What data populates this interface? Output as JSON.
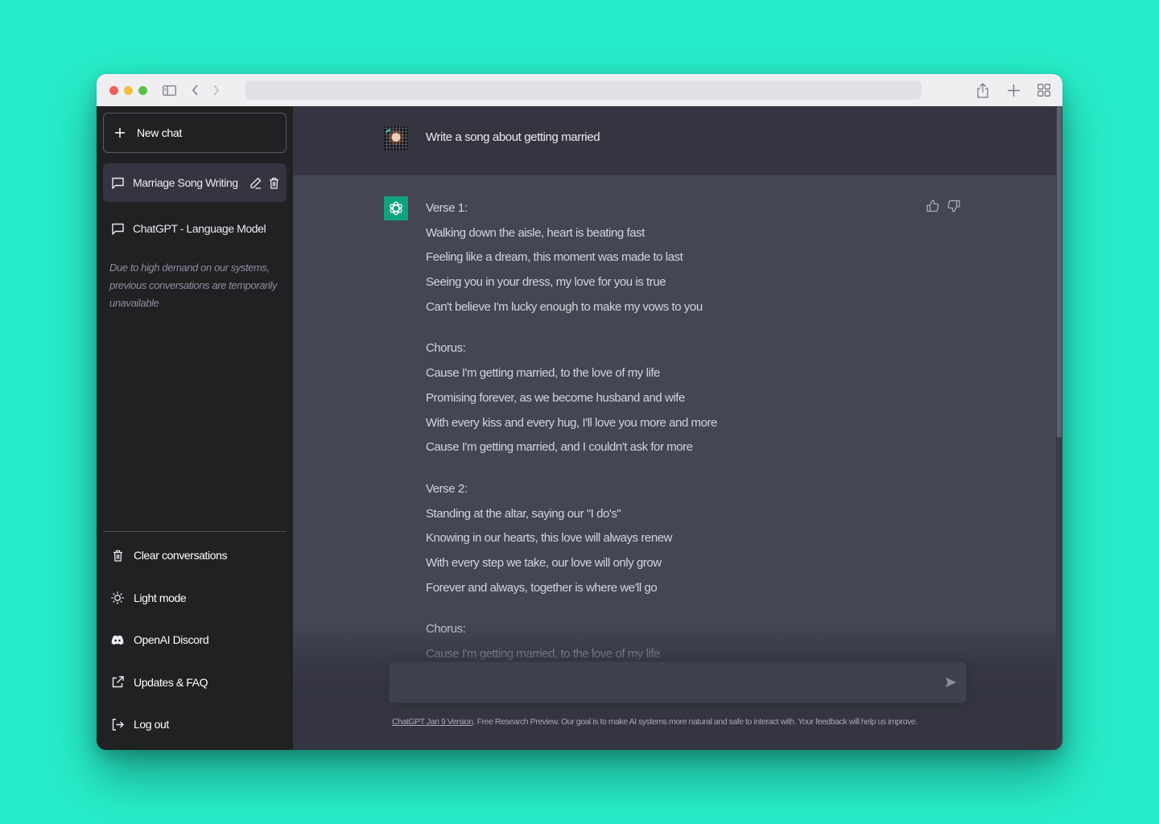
{
  "browser": {
    "url": "",
    "icons": [
      "sidebar-toggle-icon",
      "back-icon",
      "forward-icon",
      "share-icon",
      "new-tab-icon",
      "tab-overview-icon"
    ]
  },
  "sidebar": {
    "new_chat_label": "New chat",
    "conversations": [
      {
        "title": "Marriage Song Writing",
        "active": true
      },
      {
        "title": "ChatGPT - Language Model",
        "active": false
      }
    ],
    "notice": "Due to high demand on our systems, previous conversations are temporarily unavailable",
    "menu": [
      {
        "label": "Clear conversations",
        "icon": "trash-icon"
      },
      {
        "label": "Light mode",
        "icon": "sun-icon"
      },
      {
        "label": "OpenAI Discord",
        "icon": "discord-icon"
      },
      {
        "label": "Updates & FAQ",
        "icon": "external-link-icon"
      },
      {
        "label": "Log out",
        "icon": "logout-icon"
      }
    ]
  },
  "chat": {
    "user_message": "Write a song about getting married",
    "assistant_message": {
      "stanzas": [
        {
          "lines": [
            "Verse 1:",
            "Walking down the aisle, heart is beating fast",
            "Feeling like a dream, this moment was made to last",
            "Seeing you in your dress, my love for you is true",
            "Can't believe I'm lucky enough to make my vows to you"
          ]
        },
        {
          "lines": [
            "Chorus:",
            "Cause I'm getting married, to the love of my life",
            "Promising forever, as we become husband and wife",
            "With every kiss and every hug, I'll love you more and more",
            "Cause I'm getting married, and I couldn't ask for more"
          ]
        },
        {
          "lines": [
            "Verse 2:",
            "Standing at the altar, saying our \"I do's\"",
            "Knowing in our hearts, this love will always renew",
            "With every step we take, our love will only grow",
            "Forever and always, together is where we'll go"
          ]
        },
        {
          "lines": [
            "Chorus:",
            "Cause I'm getting married, to the love of my life"
          ]
        }
      ]
    },
    "input": {
      "value": "",
      "placeholder": ""
    }
  },
  "footer": {
    "link_text": "ChatGPT Jan 9 Version",
    "text": ". Free Research Preview. Our goal is to make AI systems more natural and safe to interact with. Your feedback will help us improve."
  },
  "colors": {
    "background": "#27ecc9",
    "sidebar": "#202123",
    "user_row": "#343541",
    "assistant_row": "#444654",
    "accent": "#10a37f"
  }
}
